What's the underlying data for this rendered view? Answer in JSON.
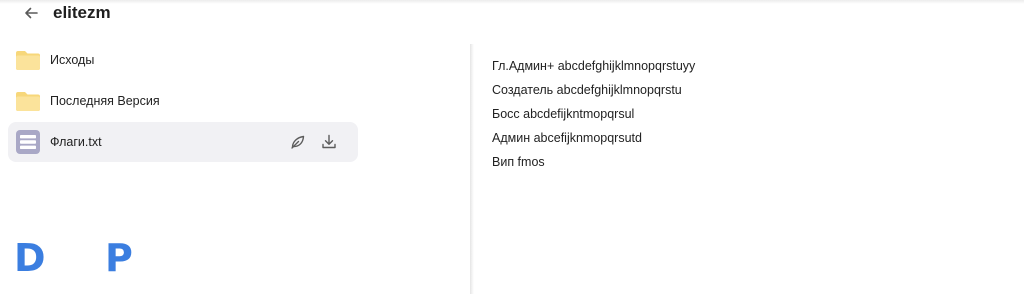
{
  "header": {
    "title": "elitezm",
    "back_icon": "arrow-left-icon"
  },
  "files": [
    {
      "label": "Исходы",
      "type": "folder",
      "icon": "folder-icon"
    },
    {
      "label": "Последняя Версия",
      "type": "folder",
      "icon": "folder-icon"
    },
    {
      "label": "Флаги.txt",
      "type": "text-file",
      "icon": "text-file-icon",
      "selected": true,
      "actions": [
        "edit-icon",
        "download-icon"
      ]
    }
  ],
  "brand": {
    "letter_left": "D",
    "letter_right": "P",
    "color": "#3b7ee0"
  },
  "preview": {
    "lines": [
      "Гл.Админ+ abcdefghijklmnopqrstuyy",
      "Создатель abcdefghijklmnopqrstu",
      "Босс abcdefijkntmopqrsul",
      "Админ abcefijknmopqrsutd",
      "Вип fmos"
    ]
  },
  "colors": {
    "folder": "#fbe39b",
    "folder_tab": "#f7d77a",
    "txt_icon": "#a9a8c6",
    "selected_row": "#f1f1f4"
  }
}
